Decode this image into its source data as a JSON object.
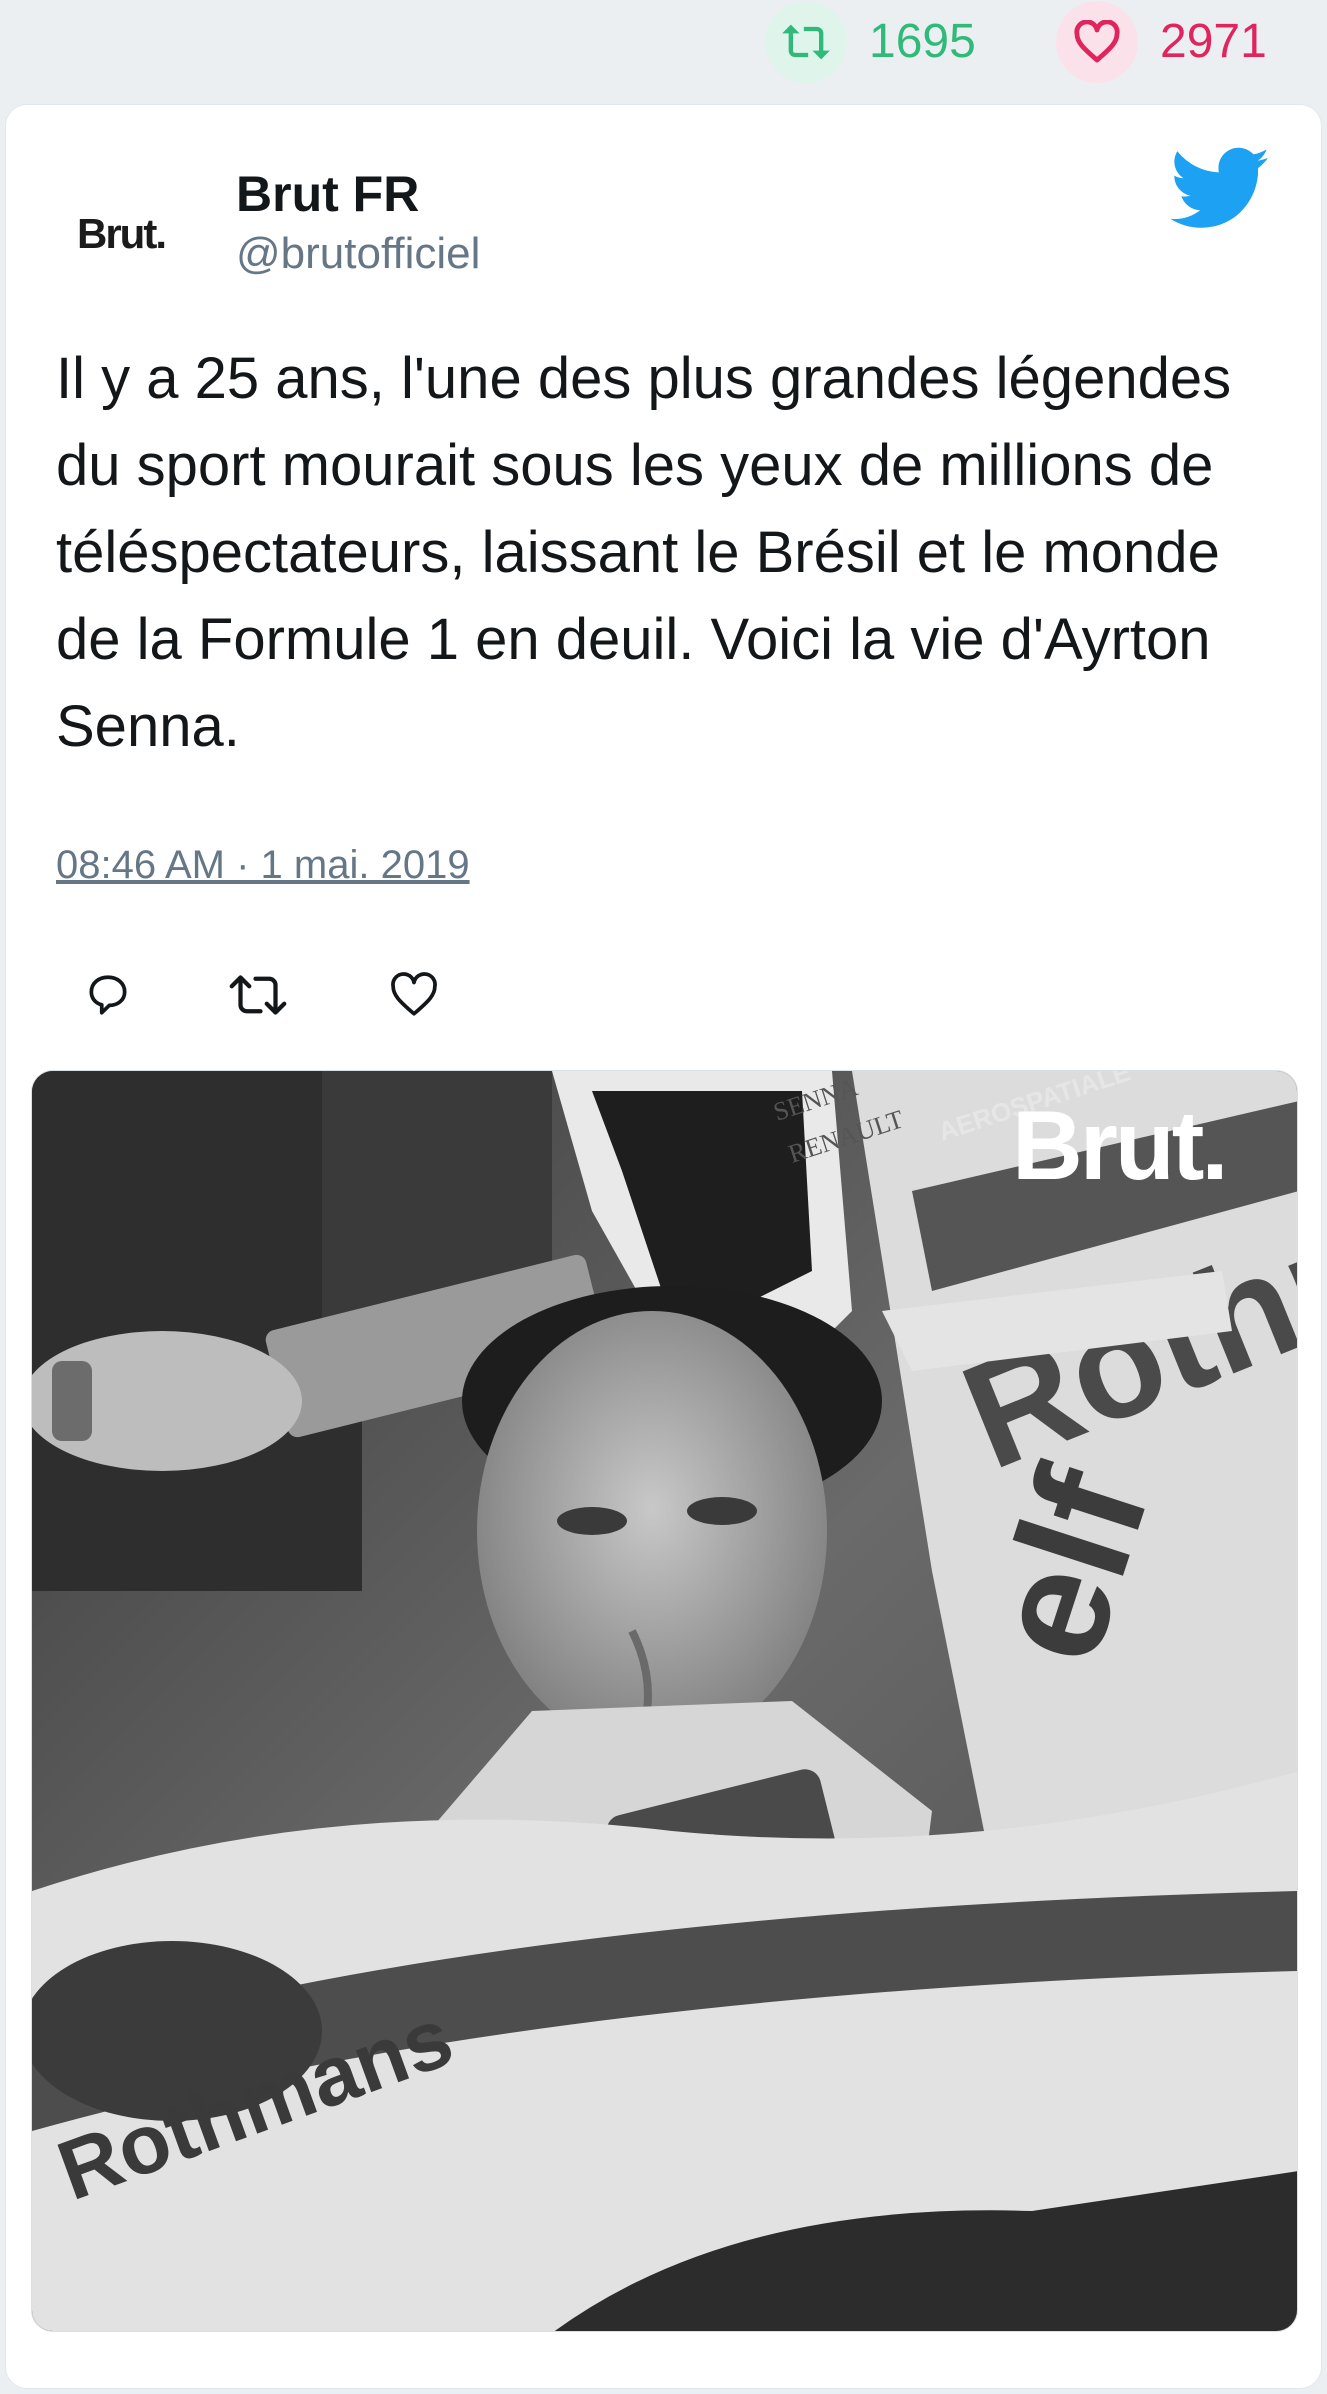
{
  "stats": {
    "retweets": "1695",
    "likes": "2971",
    "retweet_icon": "retweet-icon",
    "like_icon": "heart-icon",
    "retweet_color": "#2fba7a",
    "like_color": "#e0245e"
  },
  "tweet": {
    "avatar_text": "Brut.",
    "display_name": "Brut FR",
    "handle": "@brutofficiel",
    "brand_icon": "twitter-bird-icon",
    "brand_color": "#1da1f2",
    "text": "Il y a 25 ans, l'une des plus grandes légendes du sport mourait sous les yeux de millions de téléspectateurs, laissant le Brésil et le monde de la Formule 1 en deuil. Voici la vie d'Ayrton Senna.",
    "timestamp": "08:46 AM · 1 mai. 2019",
    "actions": {
      "reply_icon": "reply-icon",
      "retweet_icon": "retweet-icon",
      "like_icon": "heart-icon"
    }
  },
  "media": {
    "watermark": "Brut.",
    "car_livery_1": "Rothmans",
    "car_livery_2": "elf",
    "car_livery_3": "SENNA",
    "car_livery_4": "RENAULT",
    "car_livery_5": "AEROSPATIALE",
    "car_livery_6": "Rothmans",
    "car_livery_7": "elf"
  }
}
